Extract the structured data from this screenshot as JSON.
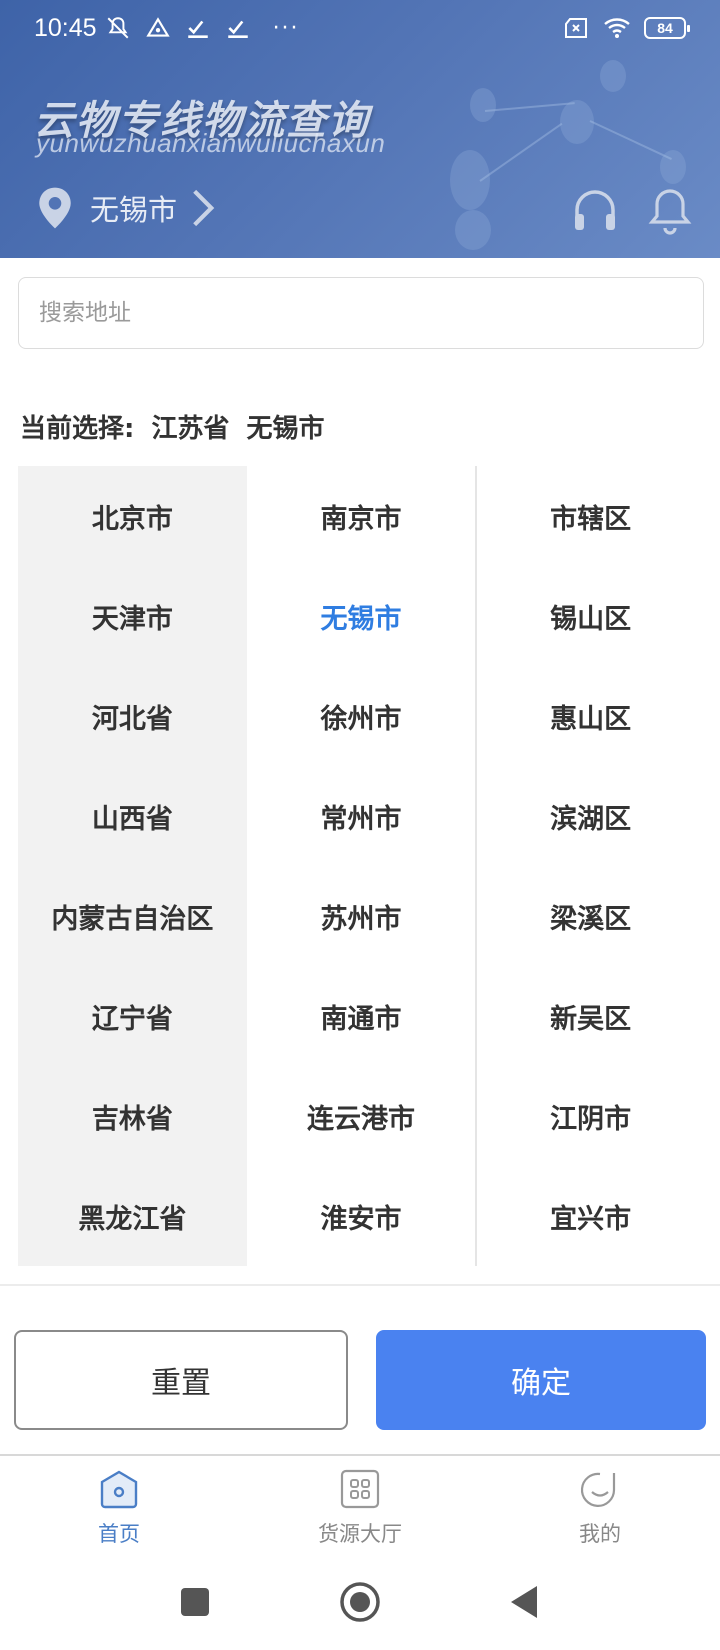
{
  "status_bar": {
    "time": "10:45",
    "dots": "···",
    "battery": "84"
  },
  "header": {
    "title": "云物专线物流查询",
    "subtitle": "yunwuzhuanxianwuliuchaxun",
    "city": "无锡市"
  },
  "search": {
    "placeholder": "搜索地址"
  },
  "selection": {
    "label": "当前选择:",
    "province": "江苏省",
    "city": "无锡市"
  },
  "picker": {
    "provinces": [
      "北京市",
      "天津市",
      "河北省",
      "山西省",
      "内蒙古自治区",
      "辽宁省",
      "吉林省",
      "黑龙江省"
    ],
    "cities": [
      "南京市",
      "无锡市",
      "徐州市",
      "常州市",
      "苏州市",
      "南通市",
      "连云港市",
      "淮安市"
    ],
    "districts": [
      "市辖区",
      "锡山区",
      "惠山区",
      "滨湖区",
      "梁溪区",
      "新吴区",
      "江阴市",
      "宜兴市"
    ],
    "active_city_index": 1,
    "active_color": "#2f7de1"
  },
  "buttons": {
    "reset": "重置",
    "confirm": "确定",
    "confirm_color": "#4a82f0"
  },
  "tabs": [
    {
      "label": "首页",
      "icon": "home-icon",
      "active": true
    },
    {
      "label": "货源大厅",
      "icon": "grid-icon",
      "active": false
    },
    {
      "label": "我的",
      "icon": "profile-icon",
      "active": false
    }
  ],
  "nav": {
    "recent": "square-icon",
    "home": "circle-icon",
    "back": "back-triangle-icon"
  }
}
